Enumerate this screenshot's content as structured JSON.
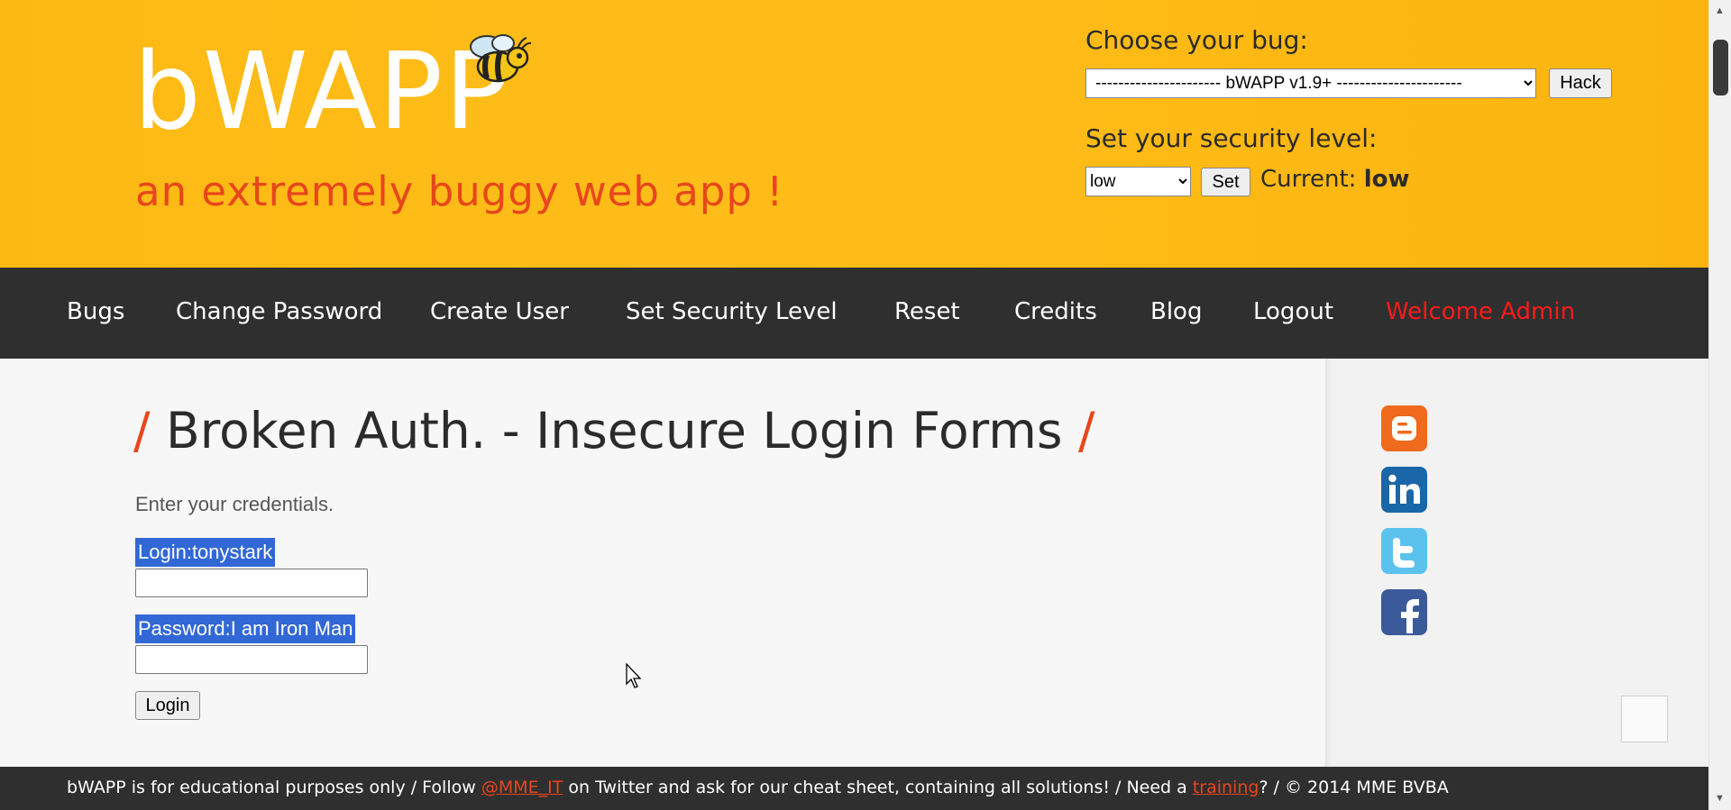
{
  "header": {
    "logo": "bWAPP",
    "tagline": "an extremely buggy web app !",
    "choose_bug_label": "Choose your bug:",
    "bug_selected": "---------------------- bWAPP v1.9+ ----------------------",
    "hack_label": "Hack",
    "security_label": "Set your security level:",
    "security_selected": "low",
    "set_label": "Set",
    "current_label": "Current: ",
    "current_value": "low"
  },
  "nav": {
    "items": [
      "Bugs",
      "Change Password",
      "Create User",
      "Set Security Level",
      "Reset",
      "Credits",
      "Blog",
      "Logout"
    ],
    "welcome": "Welcome Admin"
  },
  "main": {
    "title": "Broken Auth. - Insecure Login Forms",
    "title_slash": "/",
    "intro": "Enter your credentials.",
    "login_label": "Login:tonystark",
    "password_label": "Password:I am Iron Man",
    "login_button": "Login"
  },
  "social": [
    "blogger-icon",
    "linkedin-icon",
    "twitter-icon",
    "facebook-icon"
  ],
  "footer": {
    "part1": "bWAPP is for educational purposes only / Follow ",
    "twitter_link": "@MME_IT",
    "part2": " on Twitter and ask for our cheat sheet, containing all solutions! / Need a ",
    "training_link": "training",
    "part3": "? / © 2014 MME BVBA"
  },
  "colors": {
    "header_bg": "#fdb913",
    "nav_bg": "#2f2f2f",
    "accent": "#e8461c",
    "welcome": "#ff1a1a",
    "selection": "#3268d6"
  }
}
